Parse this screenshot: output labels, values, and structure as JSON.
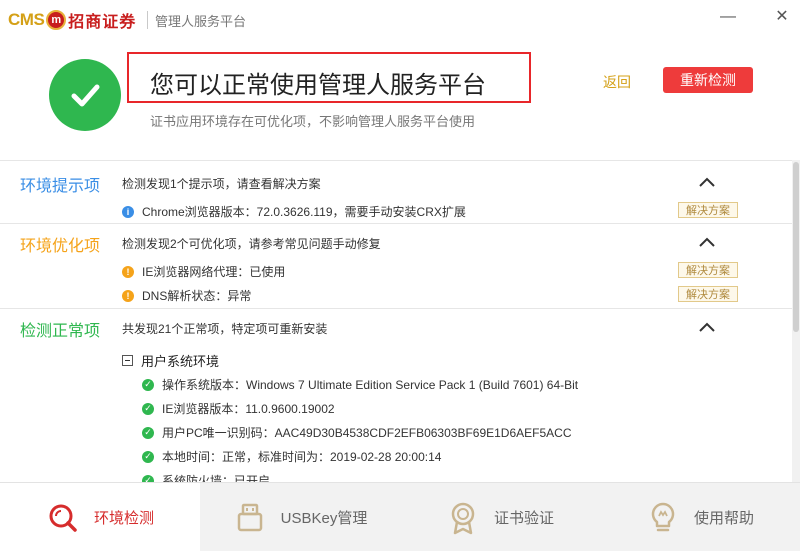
{
  "titlebar": {
    "logo_cms": "CMS",
    "logo_name": "招商证券",
    "app_title": "管理人服务平台",
    "minimize": "—",
    "close": "✕"
  },
  "header": {
    "headline": "您可以正常使用管理人服务平台",
    "subline": "证书应用环境存在可优化项，不影响管理人服务平台使用",
    "back_label": "返回",
    "recheck_label": "重新检测",
    "status_color": "#2fb74f",
    "accent_color": "#ee3b3b"
  },
  "sections": {
    "tips": {
      "title": "环境提示项",
      "color": "#3a8ee6",
      "desc": "检测发现1个提示项，请查看解决方案",
      "items": [
        {
          "text": "Chrome浏览器版本：72.0.3626.119，需要手动安装CRX扩展",
          "fix": "解决方案"
        }
      ]
    },
    "optimize": {
      "title": "环境优化项",
      "color": "#f5a31a",
      "desc": "检测发现2个可优化项，请参考常见问题手动修复",
      "items": [
        {
          "text": "IE浏览器网络代理：已使用",
          "fix": "解决方案"
        },
        {
          "text": "DNS解析状态：异常",
          "fix": "解决方案"
        }
      ]
    },
    "normal": {
      "title": "检测正常项",
      "color": "#2fb74f",
      "desc": "共发现21个正常项，特定项可重新安装",
      "group_title": "用户系统环境",
      "items": [
        "操作系统版本：Windows 7 Ultimate Edition Service Pack 1 (Build 7601) 64-Bit",
        "IE浏览器版本：11.0.9600.19002",
        "用户PC唯一识别码：AAC49D30B4538CDF2EFB06303BF69E1D6AEF5ACC",
        "本地时间：正常，标准时间为：2019-02-28 20:00:14",
        "系统防火墙：已开启"
      ]
    }
  },
  "nav": [
    {
      "label": "环境检测",
      "icon": "search-icon",
      "active": true
    },
    {
      "label": "USBKey管理",
      "icon": "usbkey-icon",
      "active": false
    },
    {
      "label": "证书验证",
      "icon": "certificate-icon",
      "active": false
    },
    {
      "label": "使用帮助",
      "icon": "help-bulb-icon",
      "active": false
    }
  ]
}
